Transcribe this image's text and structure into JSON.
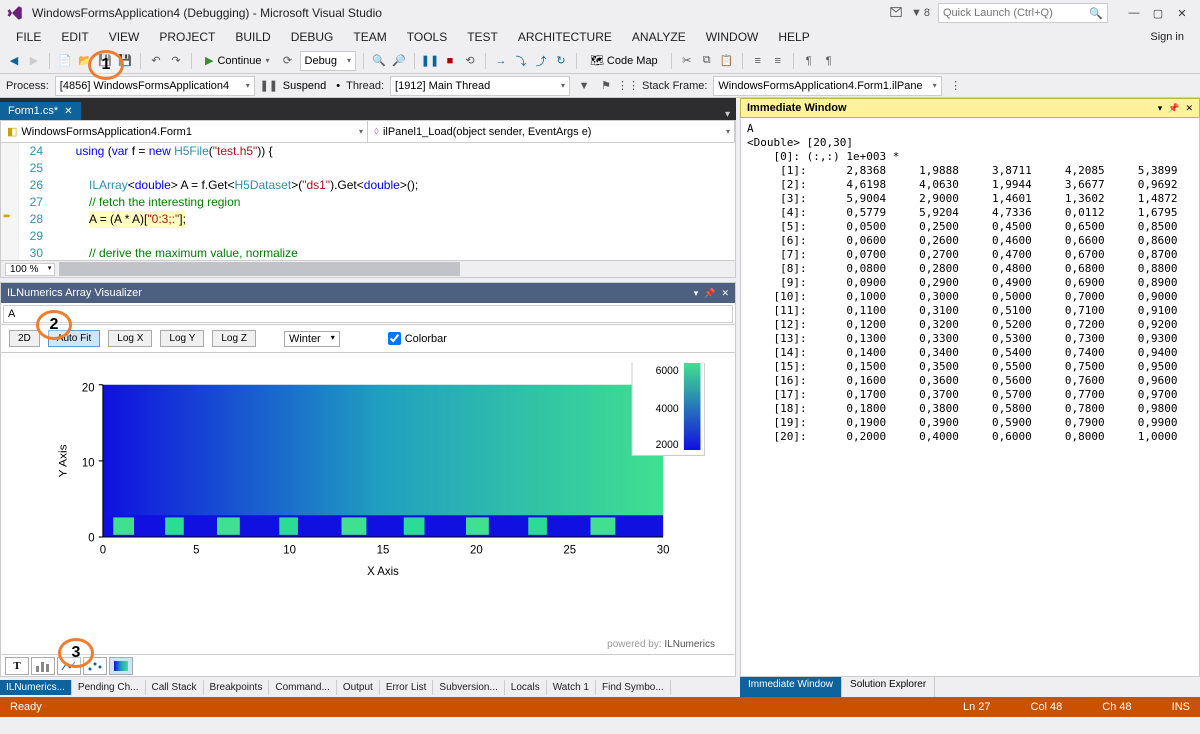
{
  "title": "WindowsFormsApplication4 (Debugging) - Microsoft Visual Studio",
  "quick_launch_placeholder": "Quick Launch (Ctrl+Q)",
  "signin": "Sign in",
  "flag_count": "8",
  "menu": [
    "FILE",
    "EDIT",
    "VIEW",
    "PROJECT",
    "BUILD",
    "DEBUG",
    "TEAM",
    "TOOLS",
    "TEST",
    "ARCHITECTURE",
    "ANALYZE",
    "WINDOW",
    "HELP"
  ],
  "toolbar": {
    "continue": "Continue",
    "config": "Debug",
    "codemap": "Code Map"
  },
  "debugbar": {
    "process_label": "Process:",
    "process_value": "[4856] WindowsFormsApplication4",
    "suspend": "Suspend",
    "thread_label": "Thread:",
    "thread_value": "[1912] Main Thread",
    "stackframe_label": "Stack Frame:",
    "stackframe_value": "WindowsFormsApplication4.Form1.ilPane"
  },
  "doc_tab": "Form1.cs*",
  "editor_combo_left": "WindowsFormsApplication4.Form1",
  "editor_combo_right": "ilPanel1_Load(object sender, EventArgs e)",
  "code_lines": {
    "24": "using (var f = new H5File(\"test.h5\")) {",
    "25": "",
    "26": "    ILArray<double> A = f.Get<H5Dataset>(\"ds1\").Get<double>();",
    "27": "    // fetch the interesting region",
    "28": "    A = (A * A)[\"0:3;:\"];",
    "29": "",
    "30": "    // derive the maximum value, normalize"
  },
  "zoom": "100 %",
  "il": {
    "title": "ILNumerics Array Visualizer",
    "expr": "A",
    "btn_2d": "2D",
    "btn_autofit": "Auto Fit",
    "btn_logx": "Log X",
    "btn_logy": "Log Y",
    "btn_logz": "Log Z",
    "colormap": "Winter",
    "colorbar_label": "Colorbar",
    "powered": "powered by:",
    "powered_name": "ILNumerics",
    "xlabel": "X Axis",
    "ylabel": "Y Axis",
    "x_ticks": [
      0,
      5,
      10,
      15,
      20,
      25,
      30
    ],
    "y_ticks": [
      0,
      10,
      20
    ],
    "cb_ticks": [
      2000,
      4000,
      6000
    ]
  },
  "chart_data": {
    "type": "heatmap",
    "title": "",
    "xlabel": "X Axis",
    "ylabel": "Y Axis",
    "xlim": [
      0,
      30
    ],
    "ylim": [
      0,
      20
    ],
    "colormap": "Winter",
    "colorbar_range": [
      0,
      6000
    ],
    "colorbar_ticks": [
      2000,
      4000,
      6000
    ],
    "note": "heatmap of A (20×30); gradient roughly increasing along X; bottom ~4 rows show irregular high-value checker pattern"
  },
  "bottom_tabs_left": [
    "ILNumerics...",
    "Pending Ch...",
    "Call Stack",
    "Breakpoints",
    "Command...",
    "Output",
    "Error List",
    "Subversion...",
    "Locals",
    "Watch 1",
    "Find Symbo..."
  ],
  "immed": {
    "title": "Immediate Window",
    "header1": "A",
    "header2": "<Double> [20,30]",
    "header3": "    [0]: (:,:) 1e+003 *",
    "rows": [
      {
        "i": "[1]:",
        "v": [
          "2,8368",
          "1,9888",
          "3,8711",
          "4,2085",
          "5,3899"
        ]
      },
      {
        "i": "[2]:",
        "v": [
          "4,6198",
          "4,0630",
          "1,9944",
          "3,6677",
          "0,9692"
        ]
      },
      {
        "i": "[3]:",
        "v": [
          "5,9004",
          "2,9000",
          "1,4601",
          "1,3602",
          "1,4872"
        ]
      },
      {
        "i": "[4]:",
        "v": [
          "0,5779",
          "5,9204",
          "4,7336",
          "0,0112",
          "1,6795"
        ]
      },
      {
        "i": "[5]:",
        "v": [
          "0,0500",
          "0,2500",
          "0,4500",
          "0,6500",
          "0,8500"
        ]
      },
      {
        "i": "[6]:",
        "v": [
          "0,0600",
          "0,2600",
          "0,4600",
          "0,6600",
          "0,8600"
        ]
      },
      {
        "i": "[7]:",
        "v": [
          "0,0700",
          "0,2700",
          "0,4700",
          "0,6700",
          "0,8700"
        ]
      },
      {
        "i": "[8]:",
        "v": [
          "0,0800",
          "0,2800",
          "0,4800",
          "0,6800",
          "0,8800"
        ]
      },
      {
        "i": "[9]:",
        "v": [
          "0,0900",
          "0,2900",
          "0,4900",
          "0,6900",
          "0,8900"
        ]
      },
      {
        "i": "[10]:",
        "v": [
          "0,1000",
          "0,3000",
          "0,5000",
          "0,7000",
          "0,9000"
        ]
      },
      {
        "i": "[11]:",
        "v": [
          "0,1100",
          "0,3100",
          "0,5100",
          "0,7100",
          "0,9100"
        ]
      },
      {
        "i": "[12]:",
        "v": [
          "0,1200",
          "0,3200",
          "0,5200",
          "0,7200",
          "0,9200"
        ]
      },
      {
        "i": "[13]:",
        "v": [
          "0,1300",
          "0,3300",
          "0,5300",
          "0,7300",
          "0,9300"
        ]
      },
      {
        "i": "[14]:",
        "v": [
          "0,1400",
          "0,3400",
          "0,5400",
          "0,7400",
          "0,9400"
        ]
      },
      {
        "i": "[15]:",
        "v": [
          "0,1500",
          "0,3500",
          "0,5500",
          "0,7500",
          "0,9500"
        ]
      },
      {
        "i": "[16]:",
        "v": [
          "0,1600",
          "0,3600",
          "0,5600",
          "0,7600",
          "0,9600"
        ]
      },
      {
        "i": "[17]:",
        "v": [
          "0,1700",
          "0,3700",
          "0,5700",
          "0,7700",
          "0,9700"
        ]
      },
      {
        "i": "[18]:",
        "v": [
          "0,1800",
          "0,3800",
          "0,5800",
          "0,7800",
          "0,9800"
        ]
      },
      {
        "i": "[19]:",
        "v": [
          "0,1900",
          "0,3900",
          "0,5900",
          "0,7900",
          "0,9900"
        ]
      },
      {
        "i": "[20]:",
        "v": [
          "0,2000",
          "0,4000",
          "0,6000",
          "0,8000",
          "1,0000"
        ]
      }
    ]
  },
  "right_bottom_tabs": [
    "Immediate Window",
    "Solution Explorer"
  ],
  "status": {
    "ready": "Ready",
    "ln": "Ln 27",
    "col": "Col 48",
    "ch": "Ch 48",
    "ins": "INS"
  },
  "callouts": [
    "1",
    "2",
    "3"
  ]
}
